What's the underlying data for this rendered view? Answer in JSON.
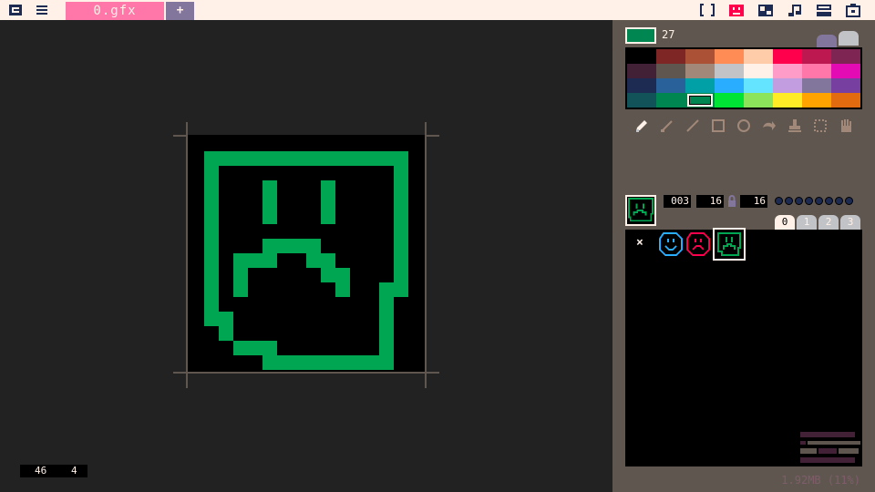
{
  "topbar": {
    "file_tab": "0.gfx",
    "add_tab": "+",
    "left_icons": [
      "app-logo-icon",
      "hamburger-menu-icon"
    ],
    "right_icons": [
      "code-editor-icon",
      "sprite-editor-icon",
      "map-editor-icon",
      "sfx-editor-icon",
      "music-editor-icon",
      "cart-icon"
    ]
  },
  "editor": {
    "coord_x": "46",
    "coord_y": "4",
    "draw_color": "#00a651"
  },
  "panel": {
    "current_color_index": "27",
    "current_color": "#008751",
    "palette": [
      "#000000",
      "#7e2525",
      "#ab5236",
      "#ff8c55",
      "#ffccaa",
      "#ff004d",
      "#be1850",
      "#7e2553",
      "#422136",
      "#5f574f",
      "#a28879",
      "#c2c3c7",
      "#fff1e8",
      "#ff9dc8",
      "#ff77a8",
      "#e40bb5",
      "#1d2b53",
      "#29629b",
      "#00a0a6",
      "#29adff",
      "#65e4ff",
      "#c29ee0",
      "#83769c",
      "#763fa0",
      "#125359",
      "#008751",
      "#008751",
      "#00e436",
      "#8be45a",
      "#ffec27",
      "#ffa300",
      "#e26a0f"
    ],
    "selected_palette_index": 26,
    "tools": [
      "pencil-icon",
      "brush-icon",
      "line-icon",
      "rectangle-icon",
      "circle-icon",
      "fill-icon",
      "stamp-icon",
      "select-icon",
      "pan-hand-icon"
    ],
    "sprite_id": "003",
    "sprite_width": "16",
    "sprite_height": "16",
    "sheet_tabs": [
      "0",
      "1",
      "2",
      "3"
    ],
    "active_sheet_tab": "0",
    "empty_slot_label": "×",
    "memory": "1.92MB (11%)"
  }
}
